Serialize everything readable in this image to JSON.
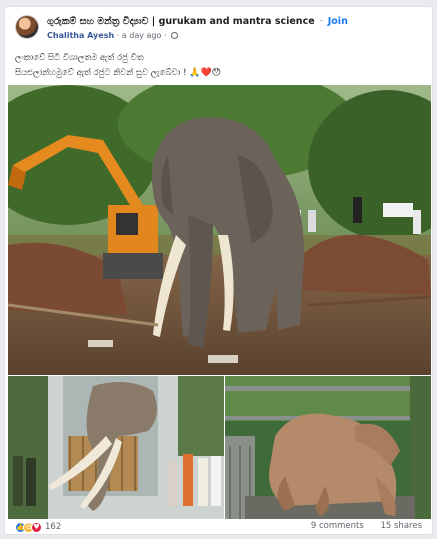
{
  "header": {
    "group_name": "ගුරුකම් සහ මන්ත්‍ර විද්‍යාව | gurukam and mantra science",
    "separator": "·",
    "join_label": "Join",
    "author": "Chalitha Ayesh",
    "time": "a day ago",
    "time_separator": "·"
  },
  "post": {
    "line1": "ලංකාවේ සිටි විශාලතම ඇත් රජු විත",
    "line2": "සියළුලාන්හමුවේ ඇත් රජුට නිවන් සුව ලැබේවා !",
    "emojis": "🙏❤️😯"
  },
  "footer": {
    "reaction_count": "162",
    "comments": "9 comments",
    "shares": "15 shares"
  },
  "icons": {
    "avatar": "group-avatar",
    "privacy": "globe-icon",
    "reactions": [
      "like-icon",
      "haha-icon",
      "love-icon"
    ]
  },
  "colors": {
    "link": "#1877f2",
    "author": "#385898",
    "text": "#1c1e21",
    "muted": "#606770"
  }
}
